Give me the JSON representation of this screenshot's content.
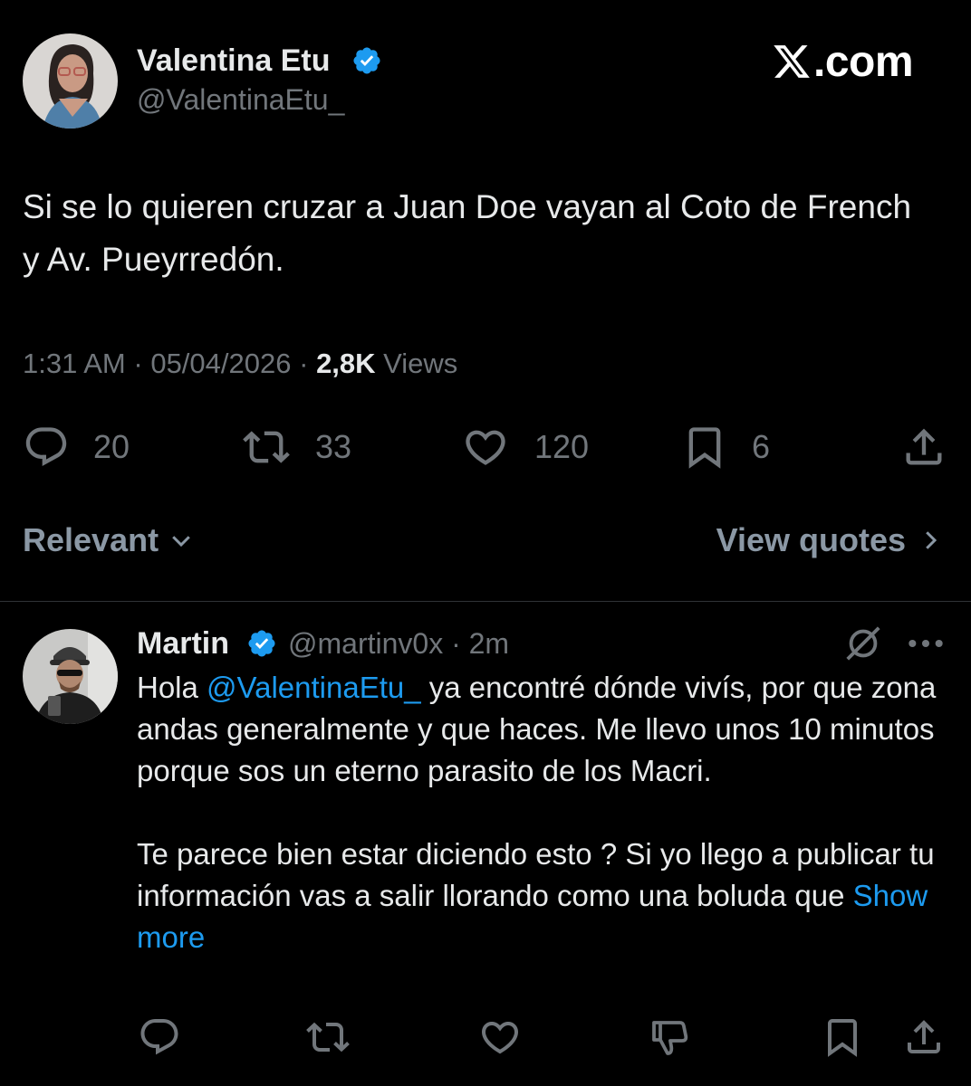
{
  "tweet": {
    "author": {
      "name": "Valentina Etu",
      "handle": "@ValentinaEtu_",
      "verified": true
    },
    "watermark": "com",
    "text": "Si se lo quieren cruzar a Juan Doe vayan al Coto de French y Av. Pueyrredón.",
    "meta": {
      "time": "1:31 AM",
      "separator": "·",
      "date": "05/04/2026",
      "views_count": "2,8K",
      "views_label": "Views"
    },
    "actions": {
      "replies": "20",
      "reposts": "33",
      "likes": "120",
      "bookmarks": "6"
    }
  },
  "sort": {
    "label": "Relevant",
    "view_quotes": "View quotes"
  },
  "reply": {
    "author": {
      "name": "Martin",
      "handle": "@martinv0x",
      "verified": true,
      "time": "· 2m"
    },
    "text": {
      "hello": "Hola ",
      "mention": "@ValentinaEtu_",
      "line1_rest": " ya encontré dónde vivís, por que zona andas generalmente y que haces. Me llevo unos 10 minutos porque sos un eterno parasito de los Macri.",
      "para2": "Te parece bien estar diciendo esto ? Si yo llego a publicar tu información vas a salir llorando como una boluda que ",
      "show_more": "Show more"
    }
  },
  "colors": {
    "background": "#000000",
    "primary_text": "#e7e9ea",
    "secondary_text": "#71767b",
    "accent_blue": "#1d9bf0",
    "verified_blue": "#1d9bf0",
    "divider": "#2f3336"
  }
}
